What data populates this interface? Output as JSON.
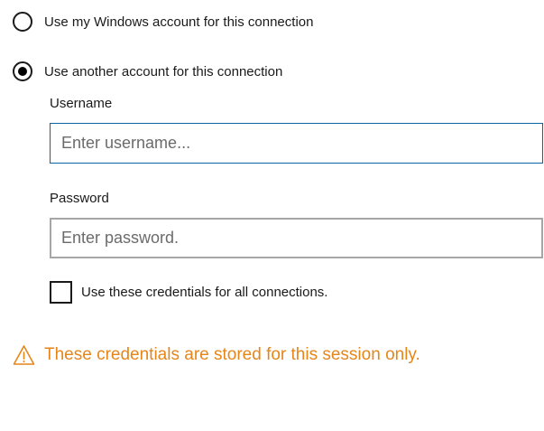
{
  "auth_options": {
    "windows_account": {
      "label": "Use my Windows account for this connection",
      "selected": false
    },
    "another_account": {
      "label": "Use another account for this connection",
      "selected": true
    }
  },
  "username": {
    "label": "Username",
    "placeholder": "Enter username...",
    "value": ""
  },
  "password": {
    "label": "Password",
    "placeholder": "Enter password.",
    "value": ""
  },
  "save_credentials": {
    "label": "Use these credentials for all connections.",
    "checked": false
  },
  "warning": {
    "icon": "warning-triangle-icon",
    "text": "These credentials are stored for this session only.",
    "color": "#e5861a"
  },
  "colors": {
    "focus_border": "#0a64a0",
    "field_border": "#a6a6a6"
  }
}
